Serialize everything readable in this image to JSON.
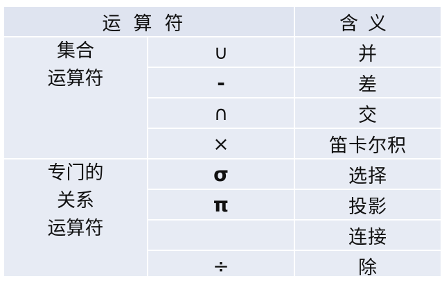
{
  "header": {
    "operator": "运算符",
    "meaning": "含义"
  },
  "groups": [
    {
      "name_lines": [
        "集合",
        "运算符"
      ],
      "rows": [
        {
          "symbol": "∪",
          "meaning": "并"
        },
        {
          "symbol": "-",
          "meaning": "差"
        },
        {
          "symbol": "∩",
          "meaning": "交"
        },
        {
          "symbol": "×",
          "meaning": "笛卡尔积"
        }
      ]
    },
    {
      "name_lines": [
        "专门的",
        "关系",
        "运算符"
      ],
      "rows": [
        {
          "symbol": "σ",
          "meaning": "选择"
        },
        {
          "symbol": "π",
          "meaning": "投影"
        },
        {
          "symbol": "",
          "meaning": "连接"
        },
        {
          "symbol": "÷",
          "meaning": "除"
        }
      ]
    }
  ]
}
